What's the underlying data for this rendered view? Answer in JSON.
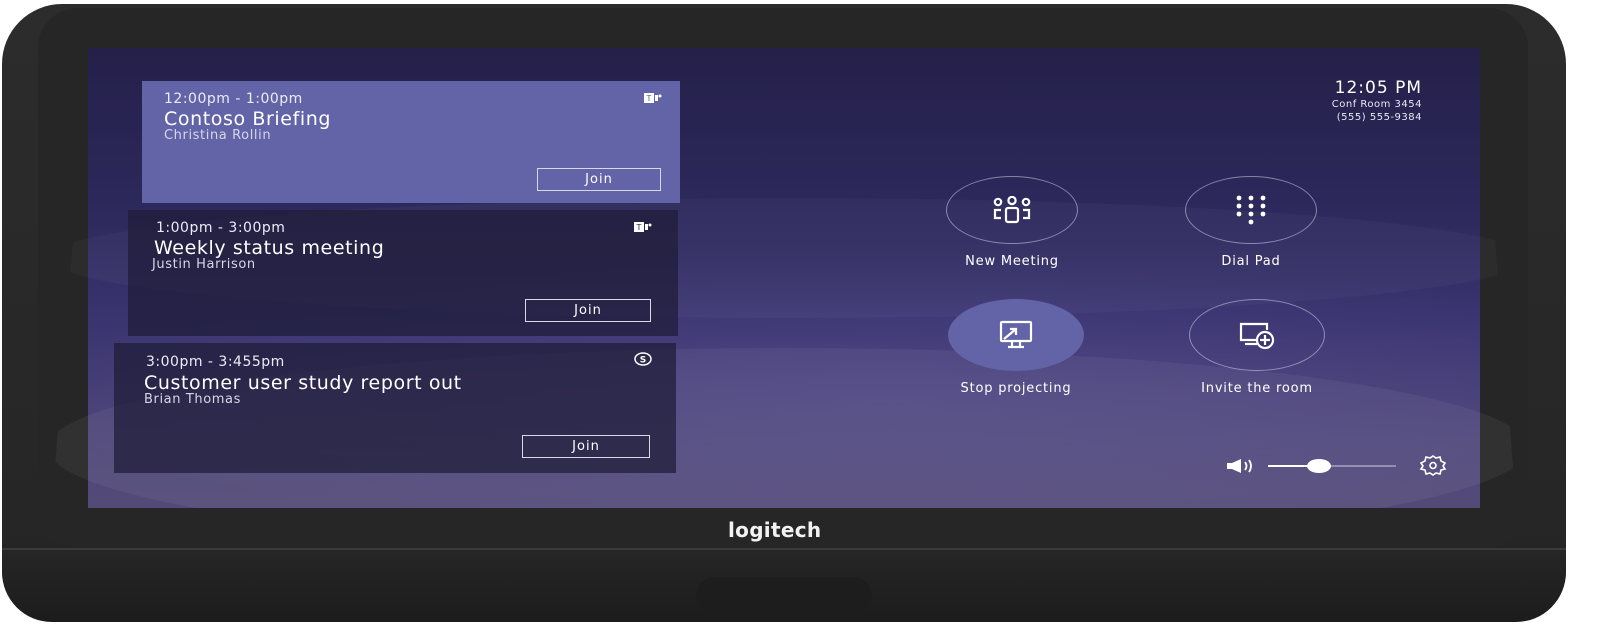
{
  "device": {
    "brand": "logitech"
  },
  "status": {
    "time": "12:05 PM",
    "room_name": "Conf Room 3454",
    "room_phone": "(555) 555-9384"
  },
  "meetings": [
    {
      "time": "12:00pm - 1:00pm",
      "title": "Contoso Briefing",
      "organizer": "Christina Rollin",
      "service": "teams-icon",
      "join_label": "Join",
      "active": true
    },
    {
      "time": "1:00pm - 3:00pm",
      "title": "Weekly status meeting",
      "organizer": "Justin Harrison",
      "service": "teams-icon",
      "join_label": "Join",
      "active": false
    },
    {
      "time": "3:00pm - 3:455pm",
      "title": "Customer user study report out",
      "organizer": "Brian Thomas",
      "service": "skype-icon",
      "join_label": "Join",
      "active": false
    }
  ],
  "actions": [
    {
      "label": "New Meeting",
      "icon": "people-icon",
      "active": false
    },
    {
      "label": "Dial Pad",
      "icon": "dialpad-icon",
      "active": false
    },
    {
      "label": "Stop projecting",
      "icon": "project-screen-icon",
      "active": true
    },
    {
      "label": "Invite the room",
      "icon": "invite-room-icon",
      "active": false
    }
  ],
  "volume": {
    "level": 0.4
  },
  "colors": {
    "accent": "#6264a7",
    "background": "#2b2758"
  }
}
